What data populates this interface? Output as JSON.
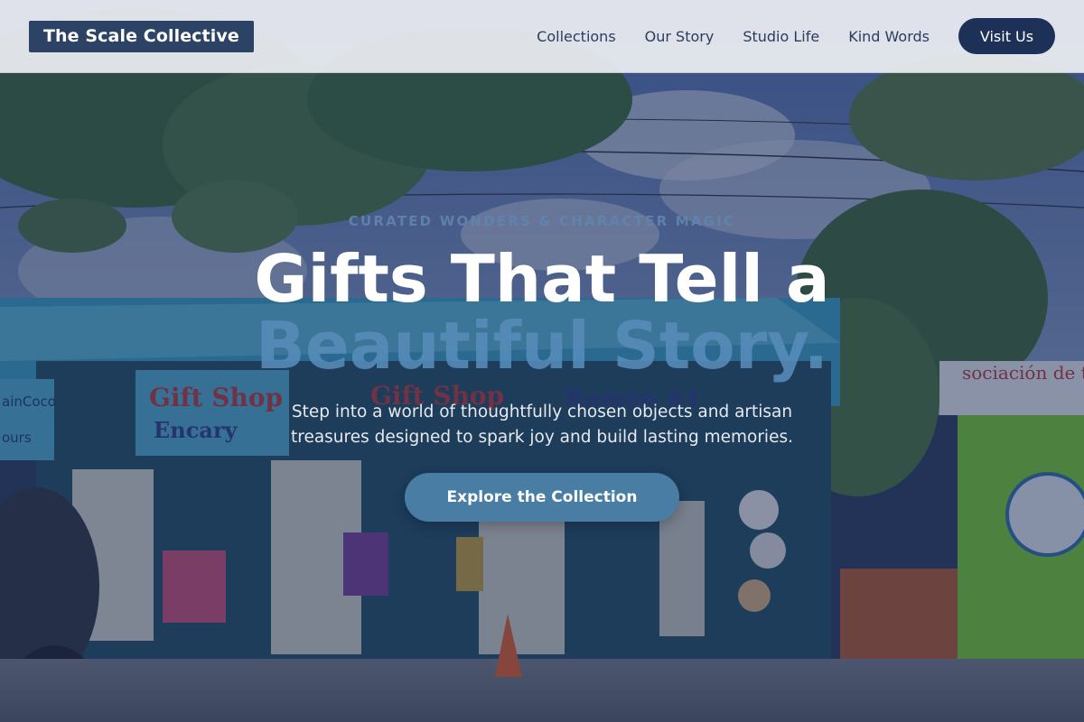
{
  "header": {
    "brand": "The Scale Collective",
    "nav": [
      {
        "label": "Collections"
      },
      {
        "label": "Our Story"
      },
      {
        "label": "Studio Life"
      },
      {
        "label": "Kind Words"
      }
    ],
    "cta_label": "Visit Us"
  },
  "hero": {
    "eyebrow": "CURATED WONDERS & CHARACTER MAGIC",
    "headline_line1": "Gifts That Tell a",
    "headline_line2": "Beautiful Story.",
    "subtitle": "Step into a world of thoughtfully chosen objects and artisan treasures designed to spark joy and build lasting memories.",
    "cta_label": "Explore the Collection",
    "background_image": {
      "shop_sign_1": "Gift Shop",
      "shop_sign_1_sub": "Encary",
      "shop_sign_2": "Gift Shop",
      "shop_sign_3": "Ramón #1",
      "side_sign": "Captain Coco Tours",
      "right_sign": "Asociación de tr"
    }
  },
  "colors": {
    "header_bg": "#eceef2",
    "brand_bg": "#2c4366",
    "nav_text": "#2a3d5c",
    "visit_button": "#1d3158",
    "cta_button": "#4a7da4",
    "headline_accent": "#588cba"
  }
}
